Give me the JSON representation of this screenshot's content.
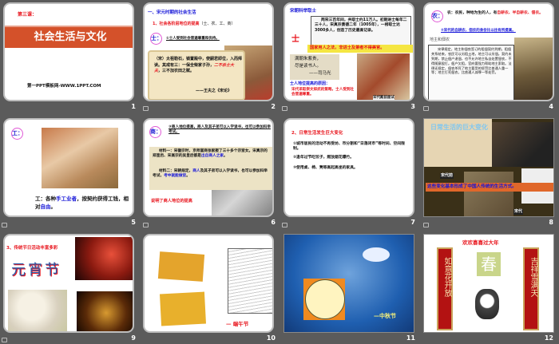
{
  "slides": [
    {
      "number": "1",
      "lesson": "第三课：",
      "title": "社会生活与文化",
      "footer": "第一PPT模板网-WWW.1PPT.COM"
    },
    {
      "number": "2",
      "heading": "一、宋元时期的社会生活",
      "sub": "1、社会各阶层地位的提高",
      "sub_note": "（士、农、工、商）",
      "badge": "士：",
      "point": "①士人受到社会普遍尊重和优待。",
      "quote": "（宋）太祖勒石，锁置殿中，使嗣君即位，入而拜读。其戒有三：一保全柴家子孙，",
      "quote_red": "二不杀士大夫",
      "quote_end": "，三不加农田之赋。",
      "source": "——王夫之《宋论》"
    },
    {
      "number": "3",
      "heading": "宋朝科举取士",
      "body": "两宋三百年间，共取士约11万人。初期进士每年二三十人，宋真宗景德二年（1005年），一榜取士达3000多人，创造了历史最高记录。",
      "char": "士",
      "banner": "国家用人之法，非进士及第者不得美官。",
      "poem1": "满朝朱紫贵，",
      "poem2": "尽是读书人。",
      "poet": "——司马光",
      "reason_title": "士人地位提高的原因：",
      "reason": "宋代采取崇文抑武的策略，士人受到社会普遍尊重。",
      "caption": "宋代殿前面试"
    },
    {
      "number": "4",
      "badge": "农：",
      "intro": "农：农民，种地为生的人，有",
      "intro_red": "自耕农、半自耕农、佃农。",
      "point": "②宋代的自耕农、佃农的身份比以往有所提高。",
      "box_title": "地主和佃农",
      "box_body": "宋律规定，地主和佃农签订的租佃契约到期，租佃关系结束，农民可以另租土地，地主可以另佃。契约未到期，禁止佃户退佃，也不允许地主私自处置佃农，不得随意殴打。佃户欠租，官府要强力帮助地主索取。法律还规定，佃农杀死了地主要受的惩罚比普通人重一等；地主打死佃农，比普通人减罪一等处罚。"
    },
    {
      "number": "5",
      "badge": "工：",
      "text_a": "工：各种",
      "text_blue": "手工业者",
      "text_b": "，按契约获得工钱，相对",
      "text_blue2": "自由",
      "text_c": "。"
    },
    {
      "number": "6",
      "badge": "商：",
      "point": "③商人地位提高，商人及其子弟可以入学读书，也可以参加科举考试。",
      "m1": "材料一：宋徽宗时，京师富商张家娶了三十多个宗室女。宋真宗的郑皇后、宋高宗的吴皇后都是",
      "m1_blue": "出自商人之家",
      "m1_end": "。",
      "m2": "材料二：宋朝规定，",
      "m2_blue": "商人",
      "m2_mid": "及其子弟可以入学读书，也可以参加科举考试，",
      "m2_blue2": "考中就能做官",
      "m2_end": "。",
      "conclusion": "说明了商人地位的提高"
    },
    {
      "number": "7",
      "heading": "2、日常生活发生巨大变化",
      "p1": "①城市居民的活动不再受坊、市分割和“日落闭市”等时间、空间限制。",
      "p2": "②逢年过节吃饺子，燃放烟花爆竹。",
      "p3": "③使用桌、椅、凳等高起高坐的家具。"
    },
    {
      "number": "8",
      "title": "日常生活的巨大变化",
      "label_before": "宋代前",
      "banner": "这些变化基本形成了中国人传统的生活方式。",
      "label_song": "宋代"
    },
    {
      "number": "9",
      "heading": "3、传统节日活动丰富多彩",
      "festival": "元宵节"
    },
    {
      "number": "10",
      "festival": "— 端午节"
    },
    {
      "number": "11",
      "festival": "—中秋节"
    },
    {
      "number": "12",
      "banner": "欢欢喜喜过大年",
      "left": "如意花开放",
      "right": "吉祥雪满天",
      "center": "春"
    }
  ],
  "colors": {
    "background": "#5b5b5b",
    "title_bar": "#d4512a",
    "red": "#e8141c",
    "blue": "#1515d8"
  }
}
